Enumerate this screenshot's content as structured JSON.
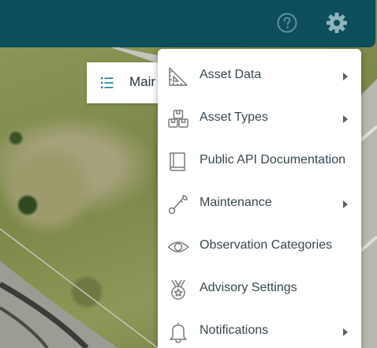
{
  "header": {
    "help_icon": "help-circle-icon",
    "settings_icon": "gear-icon",
    "accent": "#0c4e5c"
  },
  "panel": {
    "title": "Mair",
    "icon": "list-icon"
  },
  "menu": {
    "items": [
      {
        "label": "Asset Data",
        "icon": "ruler-triangle-icon",
        "has_submenu": true
      },
      {
        "label": "Asset Types",
        "icon": "boxes-icon",
        "has_submenu": true
      },
      {
        "label": "Public API Documentation",
        "icon": "book-icon",
        "has_submenu": false
      },
      {
        "label": "Maintenance",
        "icon": "wrench-icon",
        "has_submenu": true
      },
      {
        "label": "Observation Categories",
        "icon": "eye-icon",
        "has_submenu": false
      },
      {
        "label": "Advisory Settings",
        "icon": "medal-icon",
        "has_submenu": false
      },
      {
        "label": "Notifications",
        "icon": "bell-icon",
        "has_submenu": true
      }
    ]
  }
}
